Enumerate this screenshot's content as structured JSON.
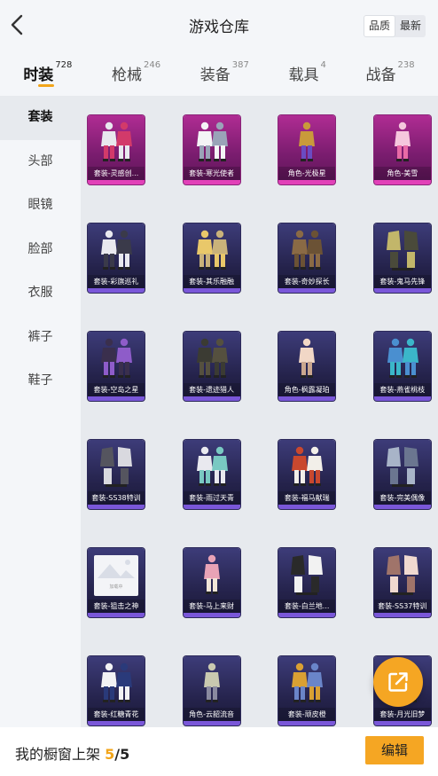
{
  "header": {
    "title": "游戏仓库",
    "sort_options": [
      "品质",
      "最新"
    ],
    "sort_active": 0
  },
  "tabs": [
    {
      "label": "时装",
      "count": "728",
      "active": true
    },
    {
      "label": "枪械",
      "count": "246"
    },
    {
      "label": "装备",
      "count": "387"
    },
    {
      "label": "载具",
      "count": "4"
    },
    {
      "label": "战备",
      "count": "238"
    }
  ],
  "sidebar": {
    "items": [
      "套装",
      "头部",
      "眼镜",
      "脸部",
      "衣服",
      "裤子",
      "鞋子"
    ],
    "active": 0
  },
  "items": [
    {
      "name": "套装-灵感创...",
      "rarity": "legendary",
      "art": "pair"
    },
    {
      "name": "套装-寒光使者",
      "rarity": "legendary",
      "art": "pair"
    },
    {
      "name": "角色-光极星",
      "rarity": "legendary",
      "art": "single"
    },
    {
      "name": "角色-美雪",
      "rarity": "legendary",
      "art": "single"
    },
    {
      "name": "套装-彩旗巡礼",
      "rarity": "epic",
      "art": "pair"
    },
    {
      "name": "套装-其乐融融",
      "rarity": "epic",
      "art": "pair"
    },
    {
      "name": "套装-奇妙探长",
      "rarity": "epic",
      "art": "pair"
    },
    {
      "name": "套装-鬼马先锋",
      "rarity": "epic",
      "art": "outfit"
    },
    {
      "name": "套装-空岛之星",
      "rarity": "epic",
      "art": "pair"
    },
    {
      "name": "套装-遗迹猎人",
      "rarity": "epic",
      "art": "pair"
    },
    {
      "name": "角色-枫露凝珀",
      "rarity": "epic",
      "art": "single"
    },
    {
      "name": "套装-燕雀桃枝",
      "rarity": "epic",
      "art": "pair"
    },
    {
      "name": "套装-SS38特训",
      "rarity": "epic",
      "art": "outfit"
    },
    {
      "name": "套装-雨过天青",
      "rarity": "epic",
      "art": "pair"
    },
    {
      "name": "套装-福马献瑞",
      "rarity": "epic",
      "art": "pair"
    },
    {
      "name": "套装-完美偶像",
      "rarity": "epic",
      "art": "outfit"
    },
    {
      "name": "套装-狙击之神",
      "rarity": "epic",
      "art": "placeholder",
      "placeholder_text": "加载中"
    },
    {
      "name": "套装-马上来财",
      "rarity": "epic",
      "art": "single"
    },
    {
      "name": "套装-白兰地...",
      "rarity": "epic",
      "art": "outfit"
    },
    {
      "name": "套装-SS37特训",
      "rarity": "epic",
      "art": "outfit"
    },
    {
      "name": "套装-红糖青花",
      "rarity": "epic",
      "art": "pair"
    },
    {
      "name": "角色-云韶流音",
      "rarity": "epic",
      "art": "single"
    },
    {
      "name": "套装-顽皮橙",
      "rarity": "epic",
      "art": "pair"
    },
    {
      "name": "套装-月光旧梦",
      "rarity": "epic",
      "art": "pair"
    }
  ],
  "footer": {
    "label": "我的橱窗上架 ",
    "shown": "5",
    "separator": "/",
    "total": "5",
    "edit_label": "编辑"
  },
  "colors": {
    "accent": "#f5a623",
    "legendary": "#b02c93",
    "epic": "#3d3c79"
  },
  "icons": {
    "back": "chevron-left-icon",
    "share": "external-link-icon"
  }
}
